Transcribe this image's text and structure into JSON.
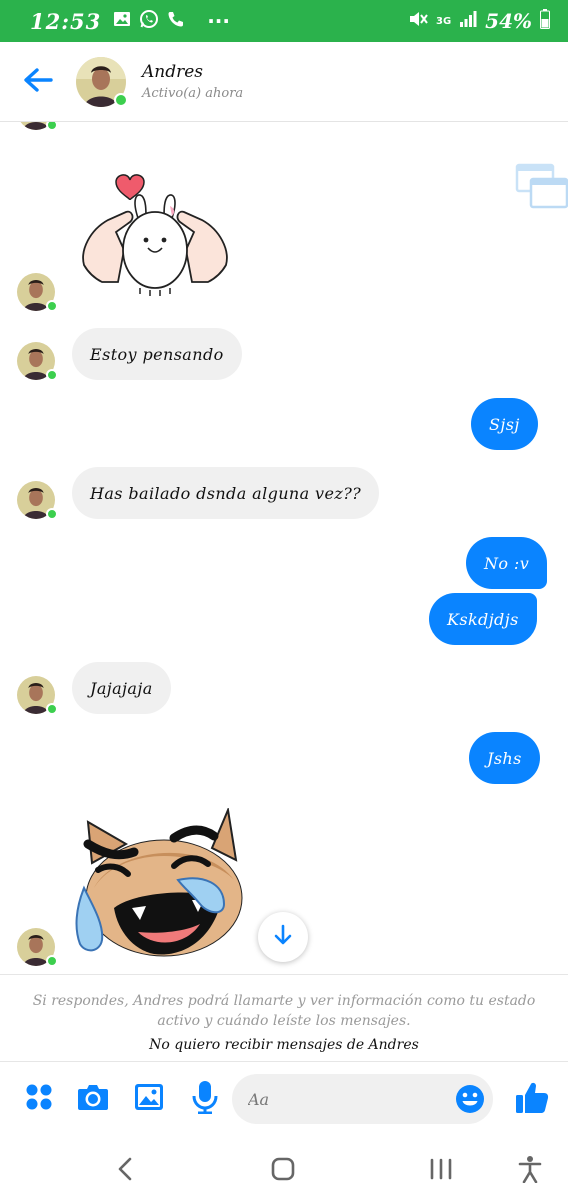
{
  "status_bar": {
    "time": "12:53",
    "network": "3G",
    "battery": "54%",
    "more_indicator": "···"
  },
  "header": {
    "contact_name": "Andres",
    "status": "Activo(a) ahora"
  },
  "messages": [
    {
      "type": "sticker",
      "from": "contact",
      "sticker": "bunny-heart-sticker"
    },
    {
      "type": "text",
      "from": "contact",
      "text": "Estoy pensando"
    },
    {
      "type": "text",
      "from": "me",
      "text": "Sjsj"
    },
    {
      "type": "text",
      "from": "contact",
      "text": "Has bailado dsnda alguna vez??"
    },
    {
      "type": "text",
      "from": "me",
      "text": "No :v"
    },
    {
      "type": "text",
      "from": "me",
      "text": "Kskdjdjs"
    },
    {
      "type": "text",
      "from": "contact",
      "text": "Jajajaja"
    },
    {
      "type": "text",
      "from": "me",
      "text": "Jshs"
    },
    {
      "type": "sticker",
      "from": "contact",
      "sticker": "crying-laughing-cat-sticker"
    }
  ],
  "notice": {
    "text": "Si respondes, Andres podrá llamarte y ver información como tu estado activo y cuándo leíste los mensajes.",
    "link": "No quiero recibir mensajes de Andres"
  },
  "composer": {
    "placeholder": "Aa"
  },
  "colors": {
    "status_bar": "#2bb24c",
    "accent": "#0a84ff",
    "incoming_bubble": "#f0f0f0",
    "online": "#3ccf4e"
  },
  "icons": {
    "back": "arrow-left-icon",
    "more_actions": "four-dots-icon",
    "camera": "camera-icon",
    "gallery": "image-icon",
    "mic": "microphone-icon",
    "emoji": "smiley-icon",
    "like": "thumbs-up-icon",
    "scroll_down": "arrow-down-icon"
  }
}
